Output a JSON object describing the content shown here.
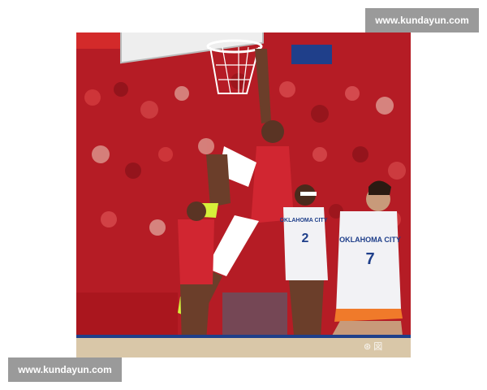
{
  "watermark_top": {
    "text": "www.kundayun.com"
  },
  "watermark_bottom": {
    "text": "www.kundayun.com"
  },
  "photo": {
    "alt": "Basketball player dunking in red uniform over defenders in white",
    "credit": "⊛ 図",
    "jersey_left": "OKLAHOMA CITY",
    "jersey_left_number": "2",
    "jersey_right": "OKLAHOMA CITY",
    "jersey_right_number": "7",
    "colors": {
      "crowd_red": "#c0202a",
      "jersey_red": "#d12631",
      "white_jersey": "#f2f2f5",
      "orange_trim": "#f07a2a",
      "court": "#d9c7a8",
      "backboard": "#f4f4f4",
      "shoes": "#d6f03a"
    }
  }
}
